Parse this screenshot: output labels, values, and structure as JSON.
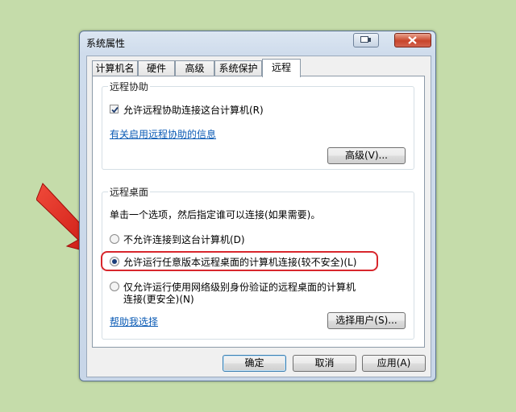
{
  "window": {
    "title": "系统属性"
  },
  "tabs": [
    {
      "label": "计算机名",
      "active": false
    },
    {
      "label": "硬件",
      "active": false
    },
    {
      "label": "高级",
      "active": false
    },
    {
      "label": "系统保护",
      "active": false
    },
    {
      "label": "远程",
      "active": true
    }
  ],
  "remote_assistance": {
    "title": "远程协助",
    "allow_checkbox_label": "允许远程协助连接这台计算机(R)",
    "allow_checked": true,
    "info_link": "有关启用远程协助的信息",
    "advanced_button": "高级(V)..."
  },
  "remote_desktop": {
    "title": "远程桌面",
    "instruction": "单击一个选项，然后指定谁可以连接(如果需要)。",
    "options": [
      {
        "label": "不允许连接到这台计算机(D)",
        "checked": false
      },
      {
        "label": "允许运行任意版本远程桌面的计算机连接(较不安全)(L)",
        "checked": true
      },
      {
        "label_line1": "仅允许运行使用网络级别身份验证的远程桌面的计算机",
        "label_line2": "连接(更安全)(N)",
        "checked": false
      }
    ],
    "help_link": "帮助我选择",
    "select_users_button": "选择用户(S)..."
  },
  "buttons": {
    "ok": "确定",
    "cancel": "取消",
    "apply": "应用(A)"
  },
  "colors": {
    "highlight": "#d8262c",
    "arrow": "#e0201c",
    "link": "#0b5bb5",
    "background": "#c5dcaa"
  }
}
